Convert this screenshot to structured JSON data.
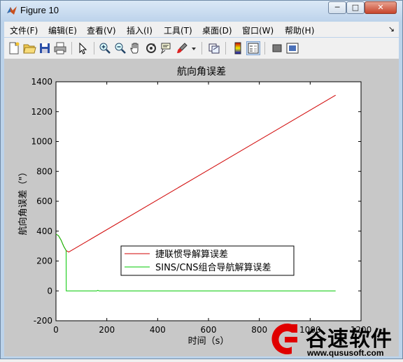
{
  "window": {
    "title": "Figure 10",
    "controls": {
      "minimize": "─",
      "maximize": "□",
      "close": "✕"
    }
  },
  "menubar": {
    "items": [
      "文件(F)",
      "编辑(E)",
      "查看(V)",
      "插入(I)",
      "工具(T)",
      "桌面(D)",
      "窗口(W)",
      "帮助(H)"
    ],
    "overflow_arrow": "↘"
  },
  "toolbar": {
    "buttons": [
      "new-figure",
      "open-file",
      "save",
      "print",
      "select-arrow",
      "zoom-in",
      "zoom-out",
      "pan",
      "rotate-3d",
      "data-cursor",
      "brush",
      "brush-dropdown",
      "link-plot",
      "colorbar",
      "legend",
      "hide-plot-tools",
      "show-plot-tools"
    ]
  },
  "chart_data": {
    "type": "line",
    "title": "航向角误差",
    "xlabel": "时间（s）",
    "ylabel": "航向角误差（\"）",
    "xlim": [
      0,
      1200
    ],
    "ylim": [
      -200,
      1400
    ],
    "xticks": [
      0,
      200,
      400,
      600,
      800,
      1000,
      1200
    ],
    "yticks": [
      -200,
      0,
      200,
      400,
      600,
      800,
      1000,
      1200,
      1400
    ],
    "grid": false,
    "legend_position": "lower-middle",
    "series": [
      {
        "name": "捷联惯导解算误差",
        "color": "#d00000",
        "x": [
          0,
          10,
          20,
          30,
          40,
          50,
          1100
        ],
        "y": [
          380,
          370,
          340,
          300,
          270,
          260,
          1310
        ]
      },
      {
        "name": "SINS/CNS组合导航解算误差",
        "color": "#00c800",
        "x": [
          0,
          10,
          20,
          30,
          40,
          40.5,
          100,
          160,
          165,
          170,
          1100
        ],
        "y": [
          380,
          370,
          340,
          300,
          270,
          0,
          0,
          0,
          4,
          0,
          0
        ]
      }
    ]
  },
  "watermark": {
    "brand_cn": "谷速软件",
    "url": "www.qususoft.com",
    "color": "#e00000"
  }
}
